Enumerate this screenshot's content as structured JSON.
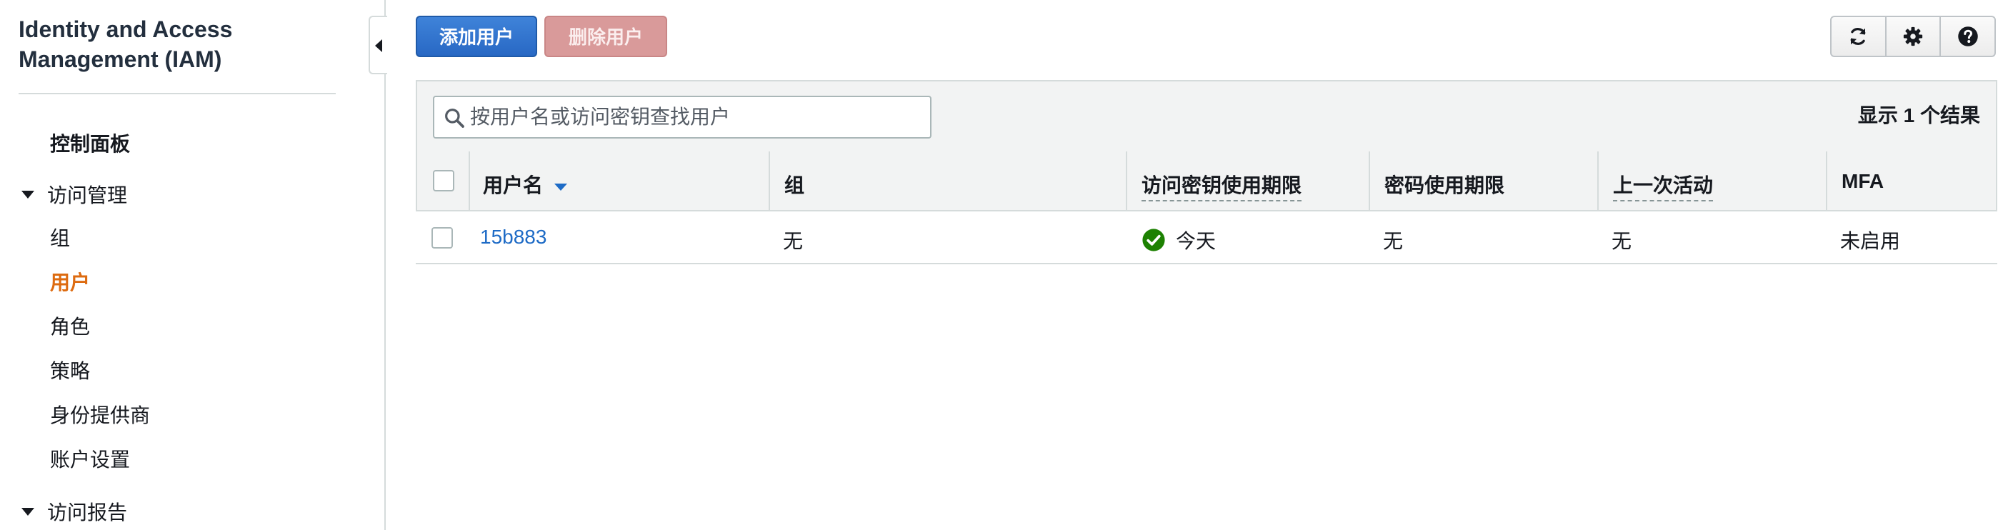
{
  "sidebar": {
    "title": "Identity and Access Management (IAM)",
    "dashboard": "控制面板",
    "access_management": {
      "label": "访问管理",
      "items": [
        {
          "label": "组",
          "active": false
        },
        {
          "label": "用户",
          "active": true
        },
        {
          "label": "角色",
          "active": false
        },
        {
          "label": "策略",
          "active": false
        },
        {
          "label": "身份提供商",
          "active": false
        },
        {
          "label": "账户设置",
          "active": false
        }
      ]
    },
    "access_reports": {
      "label": "访问报告"
    }
  },
  "toolbar": {
    "add_user_label": "添加用户",
    "delete_user_label": "删除用户",
    "icons": [
      "refresh-icon",
      "gear-icon",
      "help-icon"
    ]
  },
  "search": {
    "placeholder": "按用户名或访问密钥查找用户",
    "value": ""
  },
  "results": {
    "label": "显示 1 个结果"
  },
  "table": {
    "columns": [
      "用户名",
      "组",
      "访问密钥使用期限",
      "密码使用期限",
      "上一次活动",
      "MFA"
    ],
    "sort_column": "用户名",
    "rows": [
      {
        "username": "15b883",
        "groups": "无",
        "access_key_age": "今天",
        "password_age": "无",
        "last_activity": "无",
        "mfa": "未启用"
      }
    ]
  },
  "colors": {
    "primary": "#2868c4",
    "danger_disabled": "#d99a9a",
    "active_nav": "#dd6b10",
    "link": "#1e6bc6",
    "success": "#1d8102"
  }
}
